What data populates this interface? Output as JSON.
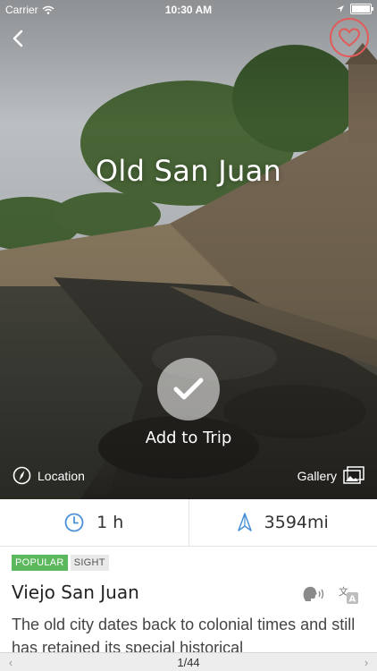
{
  "status_bar": {
    "carrier": "Carrier",
    "time": "10:30 AM"
  },
  "hero": {
    "title": "Old San Juan",
    "add_to_trip_label": "Add to Trip",
    "location_label": "Location",
    "gallery_label": "Gallery",
    "favorite_color": "#e35a5a"
  },
  "stats": {
    "duration": "1 h",
    "distance_value": "3594",
    "distance_unit": "mi",
    "accent_color": "#4a90d9"
  },
  "details": {
    "tags": [
      "POPULAR",
      "SIGHT"
    ],
    "name": "Viejo San Juan",
    "description": "The old city dates back to colonial times and still has retained its special historical"
  },
  "pager": {
    "current": "1",
    "total": "44",
    "separator": "/"
  }
}
